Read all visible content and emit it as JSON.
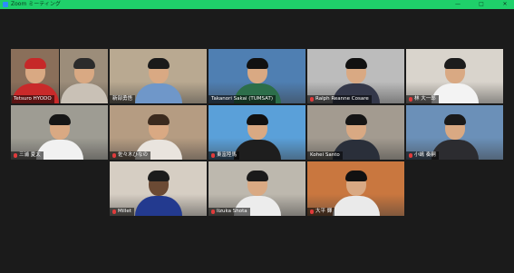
{
  "window": {
    "title": "Zoom ミーティング",
    "controls": [
      "—",
      "□",
      "✕"
    ],
    "accent": "#1fd06a"
  },
  "participants": [
    {
      "name": "Tetsuro HYODO",
      "muted": false,
      "bg": "#8a6f5a",
      "shirt": "#c92a2a",
      "hair": "#c62828"
    },
    {
      "name": "",
      "muted": false,
      "bg": "#9c8d7a",
      "shirt": "#c9c1b6",
      "hair": "#2b2b2b"
    },
    {
      "name": "新部勇悟",
      "muted": false,
      "bg": "#b9a991",
      "shirt": "#6f97c9",
      "hair": "#1a1a1a",
      "active": true
    },
    {
      "name": "Takanori Sakai (TUMSAT)",
      "muted": false,
      "bg": "#4f7fb2",
      "shirt": "#2c6e4a",
      "hair": "#111111"
    },
    {
      "name": "Ralph Reanne Cosare",
      "muted": true,
      "bg": "#bcbcbc",
      "shirt": "#34384a",
      "hair": "#111111"
    },
    {
      "name": "林 大一郎",
      "muted": true,
      "bg": "#d9d4cc",
      "shirt": "#f3f3f3",
      "hair": "#1c1c1c"
    },
    {
      "name": "三浦 夏太",
      "muted": true,
      "bg": "#9e9c93",
      "shirt": "#f1f1f1",
      "hair": "#161616"
    },
    {
      "name": "佐々木ひなの",
      "muted": true,
      "bg": "#b59c82",
      "shirt": "#e9e4de",
      "hair": "#3b2a1e"
    },
    {
      "name": "東富陸馬",
      "muted": true,
      "bg": "#5aa0d9",
      "shirt": "#1e1e1e",
      "hair": "#111111"
    },
    {
      "name": "Kohei Santo",
      "muted": false,
      "bg": "#a39b90",
      "shirt": "#2a2f3a",
      "hair": "#151515"
    },
    {
      "name": "小嶋 奏嗣",
      "muted": true,
      "bg": "#6b90b8",
      "shirt": "#2c2c30",
      "hair": "#1a1a1a"
    },
    {
      "name": "Millet",
      "muted": true,
      "bg": "#d6cec3",
      "shirt": "#233a8f",
      "hair": "#1c1c1c",
      "skin": "#6b4a34"
    },
    {
      "name": "Iizuka Shota",
      "muted": true,
      "bg": "#bdb8ae",
      "shirt": "#ececec",
      "hair": "#1a1a1a"
    },
    {
      "name": "大平 輝",
      "muted": true,
      "bg": "#c9773f",
      "shirt": "#eaeaea",
      "hair": "#111111"
    }
  ]
}
